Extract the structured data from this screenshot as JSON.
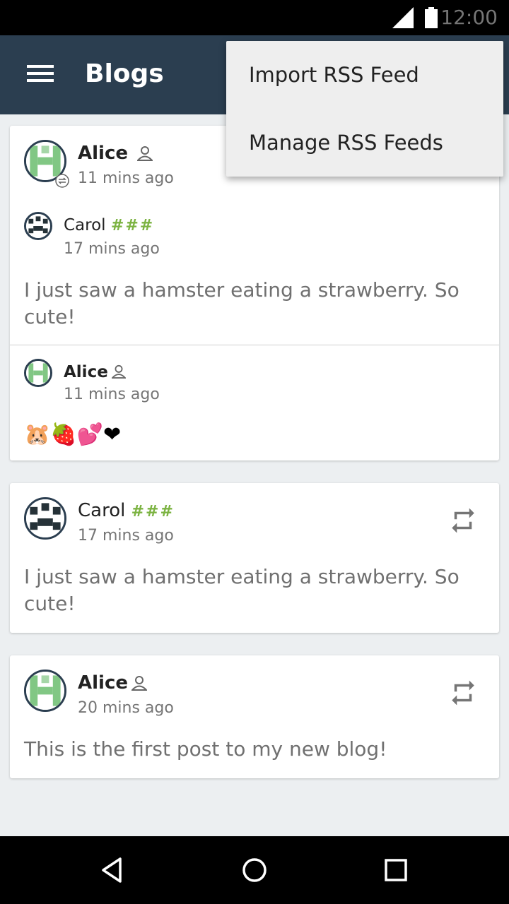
{
  "status": {
    "time": "12:00"
  },
  "app_bar": {
    "title": "Blogs"
  },
  "menu": {
    "items": [
      "Import RSS Feed",
      "Manage RSS Feeds"
    ]
  },
  "posts": [
    {
      "reposter": {
        "name": "Alice",
        "time": "11 mins ago"
      },
      "original": {
        "name": "Carol",
        "badge": "###",
        "time": "17 mins ago",
        "text": "I just saw a hamster eating a strawberry. So cute!"
      },
      "comment": {
        "name": "Alice",
        "time": "11 mins ago",
        "text": "🐹🍓💕❤"
      }
    },
    {
      "name": "Carol",
      "badge": "###",
      "time": "17 mins ago",
      "text": "I just saw a hamster eating a strawberry. So cute!"
    },
    {
      "name": "Alice",
      "time": "20 mins ago",
      "text": "This is the first post to my new blog!"
    }
  ],
  "colors": {
    "app_bar": "#2b3e50",
    "accent_green": "#7cb342",
    "background": "#eceff1"
  },
  "icons": [
    "menu-icon",
    "person-icon",
    "repost-icon",
    "back-icon",
    "home-icon",
    "recents-icon",
    "signal-icon",
    "battery-icon"
  ]
}
